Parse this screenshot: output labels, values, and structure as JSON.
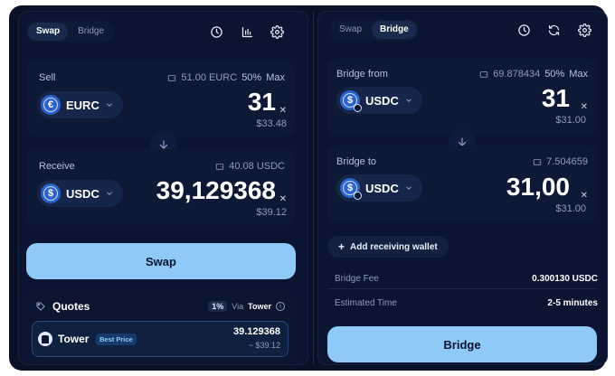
{
  "swap": {
    "tabs": [
      "Swap",
      "Bridge"
    ],
    "active_tab": "Swap",
    "sell": {
      "label": "Sell",
      "balance": "51.00 EURC",
      "pct": "50%",
      "max": "Max",
      "token": "EURC",
      "amount": "31",
      "fiat": "$33.48"
    },
    "receive": {
      "label": "Receive",
      "balance": "40.08 USDC",
      "token": "USDC",
      "amount": "39,129368",
      "fiat": "$39.12"
    },
    "button": "Swap",
    "quotes": {
      "title": "Quotes",
      "fee_badge": "1%",
      "via_label": "Via",
      "via_name": "Tower",
      "provider": "Tower",
      "best_badge": "Best Price",
      "amount": "39.129368",
      "fiat": "~ $39.12"
    }
  },
  "bridge": {
    "tabs": [
      "Swap",
      "Bridge"
    ],
    "active_tab": "Bridge",
    "from": {
      "label": "Bridge from",
      "balance": "69.878434",
      "pct": "50%",
      "max": "Max",
      "token": "USDC",
      "amount": "31",
      "fiat": "$31.00"
    },
    "to": {
      "label": "Bridge to",
      "balance": "7.504659",
      "token": "USDC",
      "amount": "31,00",
      "fiat": "$31.00"
    },
    "add_wallet": "Add receiving wallet",
    "fee_label": "Bridge Fee",
    "fee_value": "0.300130 USDC",
    "time_label": "Estimated Time",
    "time_value": "2-5 minutes",
    "button": "Bridge"
  }
}
